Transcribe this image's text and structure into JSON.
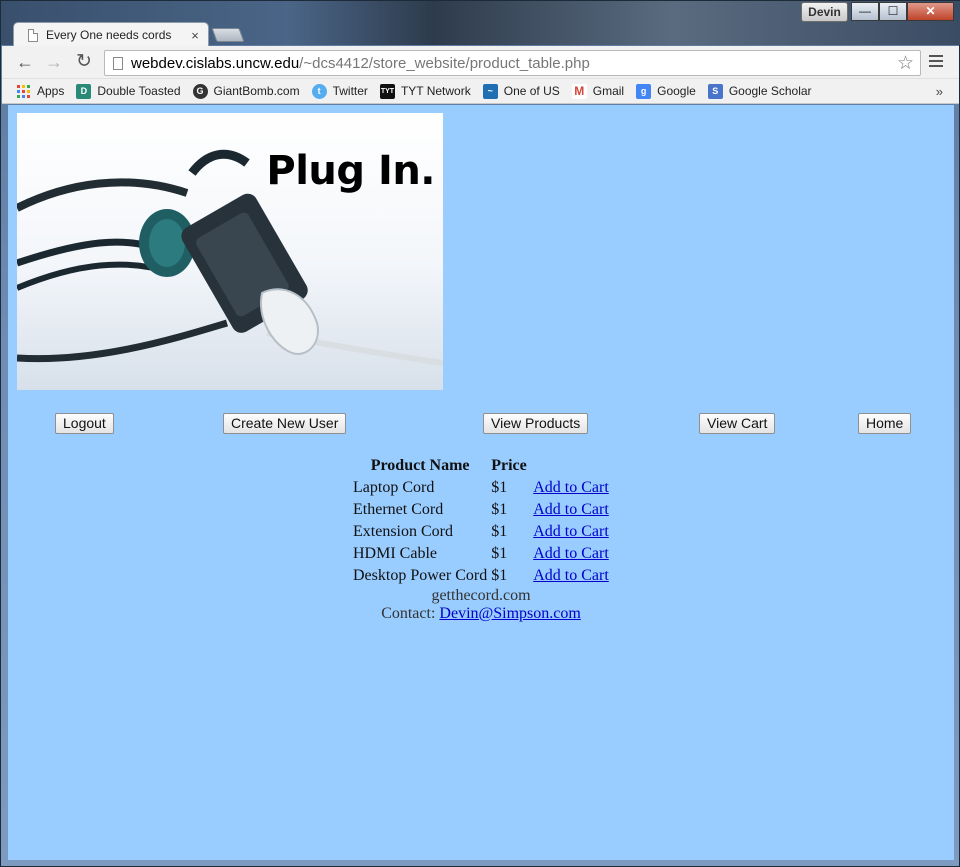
{
  "window": {
    "profile_name": "Devin",
    "minimize": "—",
    "maximize": "☐",
    "close": "✕"
  },
  "tabs": [
    {
      "title": "Every One needs cords",
      "close": "×"
    }
  ],
  "toolbar": {
    "back": "←",
    "forward": "→",
    "reload": "↻",
    "url_host": "webdev.cislabs.uncw.edu",
    "url_path": "/~dcs4412/store_website/product_table.php",
    "star": "☆"
  },
  "bookmarks": {
    "items": [
      {
        "label": "Apps",
        "icon": "apps-grid-icon"
      },
      {
        "label": "Double Toasted",
        "icon": "double-toasted-icon",
        "color": "#2a8a78"
      },
      {
        "label": "GiantBomb.com",
        "icon": "giantbomb-icon",
        "color": "#333333"
      },
      {
        "label": "Twitter",
        "icon": "twitter-icon",
        "color": "#55acee"
      },
      {
        "label": "TYT Network",
        "icon": "tyt-icon",
        "color": "#111111"
      },
      {
        "label": "One of US",
        "icon": "one-of-us-icon",
        "color": "#1f6fb2"
      },
      {
        "label": "Gmail",
        "icon": "gmail-icon",
        "color": "#d44638"
      },
      {
        "label": "Google",
        "icon": "google-icon",
        "color": "#4285f4"
      },
      {
        "label": "Google Scholar",
        "icon": "google-scholar-icon",
        "color": "#4a74c9"
      }
    ],
    "more": "»"
  },
  "page": {
    "background": "#99ccff",
    "banner_text": "Plug In.",
    "nav_buttons": {
      "logout": "Logout",
      "create_user": "Create New User",
      "view_products": "View Products",
      "view_cart": "View Cart",
      "home": "Home"
    },
    "table": {
      "headers": {
        "name": "Product Name",
        "price": "Price"
      },
      "rows": [
        {
          "name": "Laptop Cord",
          "price": "$1",
          "action": "Add to Cart"
        },
        {
          "name": "Ethernet Cord",
          "price": "$1",
          "action": "Add to Cart"
        },
        {
          "name": "Extension Cord",
          "price": "$1",
          "action": "Add to Cart"
        },
        {
          "name": "HDMI Cable",
          "price": "$1",
          "action": "Add to Cart"
        },
        {
          "name": "Desktop Power Cord",
          "price": "$1",
          "action": "Add to Cart"
        }
      ]
    },
    "footer": {
      "site": "getthecord.com",
      "contact_label": "Contact:",
      "contact_email": "Devin@Simpson.com"
    }
  }
}
